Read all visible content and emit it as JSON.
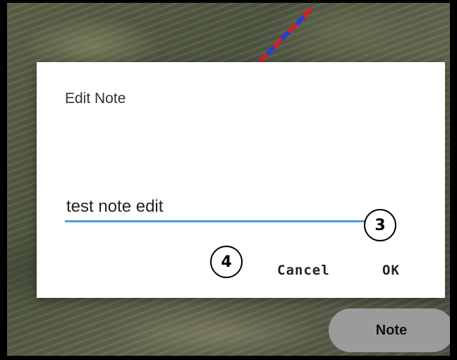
{
  "dialog": {
    "title": "Edit Note",
    "input_value": "test note edit",
    "cancel_label": "Cancel",
    "ok_label": "OK"
  },
  "annotations": {
    "marker_ok": "3",
    "marker_cancel": "4"
  },
  "map": {
    "note_button_label": "Note",
    "track_colors": [
      "#d0202a",
      "#1f3fd8"
    ]
  }
}
